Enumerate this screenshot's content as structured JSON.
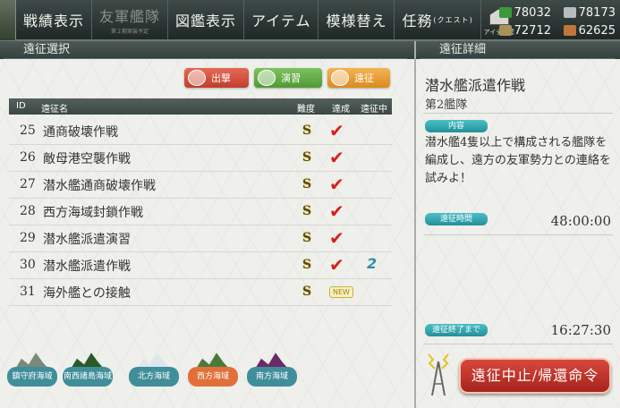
{
  "menu": {
    "items": [
      {
        "label": "戦績表示",
        "disabled": false,
        "sub": ""
      },
      {
        "label": "友軍艦隊",
        "disabled": true,
        "sub": "第２期実装予定"
      },
      {
        "label": "図鑑表示",
        "disabled": false,
        "sub": ""
      },
      {
        "label": "アイテム",
        "disabled": false,
        "sub": ""
      },
      {
        "label": "模様替え",
        "disabled": false,
        "sub": ""
      }
    ],
    "quest_label": "任務",
    "quest_small": "(クエスト)",
    "item_house_label": "アイテム屋"
  },
  "resources": {
    "fuel": "78032",
    "ammo": "72712",
    "steel": "78173",
    "bauxite": "62625"
  },
  "left": {
    "header": "遠征選択",
    "filters": {
      "sortie": "出撃",
      "exercise": "演習",
      "expedition": "遠征"
    },
    "columns": {
      "id": "ID",
      "name": "遠征名",
      "difficulty": "難度",
      "achieved": "達成",
      "in_progress": "遠征中"
    },
    "rows": [
      {
        "id": "25",
        "name": "通商破壊作戦",
        "difficulty": "S",
        "achieved": "✔",
        "fleet": "",
        "new": ""
      },
      {
        "id": "26",
        "name": "敵母港空襲作戦",
        "difficulty": "S",
        "achieved": "✔",
        "fleet": "",
        "new": ""
      },
      {
        "id": "27",
        "name": "潜水艦通商破壊作戦",
        "difficulty": "S",
        "achieved": "✔",
        "fleet": "",
        "new": ""
      },
      {
        "id": "28",
        "name": "西方海域封鎖作戦",
        "difficulty": "S",
        "achieved": "✔",
        "fleet": "",
        "new": ""
      },
      {
        "id": "29",
        "name": "潜水艦派遣演習",
        "difficulty": "S",
        "achieved": "✔",
        "fleet": "",
        "new": ""
      },
      {
        "id": "30",
        "name": "潜水艦派遣作戦",
        "difficulty": "S",
        "achieved": "✔",
        "fleet": "2",
        "new": ""
      },
      {
        "id": "31",
        "name": "海外艦との接触",
        "difficulty": "S",
        "achieved": "",
        "fleet": "",
        "new": "NEW"
      }
    ],
    "areas": [
      {
        "label": "鎮守府海域",
        "color": "#3f8e9a"
      },
      {
        "label": "南西諸島海域",
        "color": "#3f8e9a"
      },
      {
        "label": "北方海域",
        "color": "#3f8e9a"
      },
      {
        "label": "西方海域",
        "color": "#e2703a"
      },
      {
        "label": "南方海域",
        "color": "#3f8e9a"
      }
    ]
  },
  "right": {
    "header": "遠征詳細",
    "title": "潜水艦派遣作戦",
    "fleet": "第2艦隊",
    "content_tag": "内容",
    "description": "潜水艦4隻以上で構成される艦隊を編成し、遠方の友軍勢力との連絡を試みよ！",
    "time_tag": "遠征時間",
    "time": "48:00:00",
    "remain_tag": "遠征終了まで",
    "remain": "16:27:30",
    "recall_button": "遠征中止/帰還命令"
  },
  "colors": {
    "accent_teal": "#238f99",
    "check_red": "#d61f1f",
    "recall_red": "#c0302a"
  }
}
